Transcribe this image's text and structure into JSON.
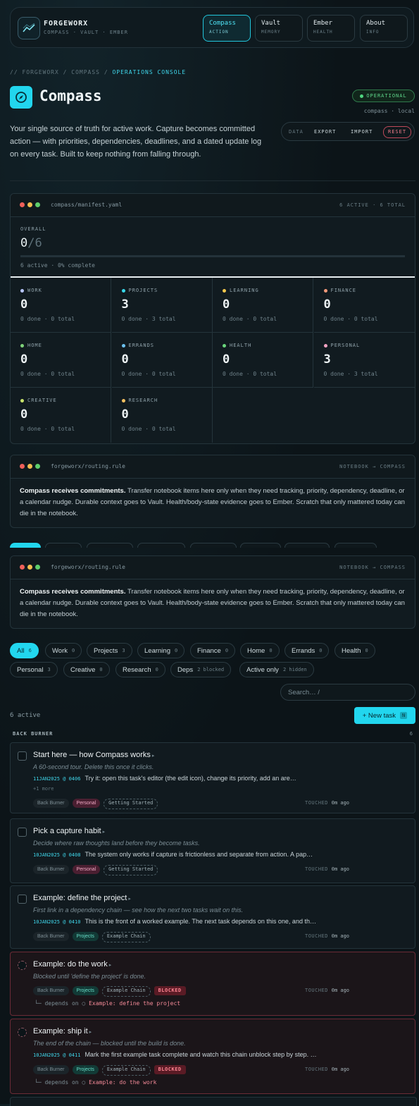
{
  "nav": {
    "brand": "FORGEWORX",
    "subtitle": "COMPASS · VAULT · EMBER",
    "tabs": [
      {
        "title": "Compass",
        "sub": "ACTION",
        "active": true
      },
      {
        "title": "Vault",
        "sub": "MEMORY",
        "active": false
      },
      {
        "title": "Ember",
        "sub": "HEALTH",
        "active": false
      },
      {
        "title": "About",
        "sub": "INFO",
        "active": false
      }
    ]
  },
  "breadcrumb": {
    "root": "// FORGEWORX",
    "sep": "/",
    "mid": "COMPASS",
    "current": "OPERATIONS CONSOLE"
  },
  "header": {
    "title": "Compass",
    "status": "OPERATIONAL",
    "host": "compass · local",
    "description": "Your single source of truth for active work. Capture becomes committed action — with priorities, dependencies, deadlines, and a dated update log on every task. Built to keep nothing from falling through."
  },
  "data_controls": {
    "label": "DATA",
    "export": "EXPORT",
    "import": "IMPORT",
    "reset": "RESET"
  },
  "manifest": {
    "file": "compass/manifest.yaml",
    "meta": "6 ACTIVE · 6 TOTAL",
    "overall_label": "OVERALL",
    "done": "0",
    "total": "/6",
    "progress": 0,
    "summary": "6 active · 0% complete",
    "categories": [
      {
        "name": "WORK",
        "value": "0",
        "sub": "0 done · 0 total",
        "color": "#b9c7ff"
      },
      {
        "name": "PROJECTS",
        "value": "3",
        "sub": "0 done · 3 total",
        "color": "#38d8ea"
      },
      {
        "name": "LEARNING",
        "value": "0",
        "sub": "0 done · 0 total",
        "color": "#f5c84c"
      },
      {
        "name": "FINANCE",
        "value": "0",
        "sub": "0 done · 0 total",
        "color": "#f59a7a"
      },
      {
        "name": "HOME",
        "value": "0",
        "sub": "0 done · 0 total",
        "color": "#7fd27a"
      },
      {
        "name": "ERRANDS",
        "value": "0",
        "sub": "0 done · 0 total",
        "color": "#6cc2f0"
      },
      {
        "name": "HEALTH",
        "value": "0",
        "sub": "0 done · 0 total",
        "color": "#6ad67c"
      },
      {
        "name": "PERSONAL",
        "value": "3",
        "sub": "0 done · 3 total",
        "color": "#f4a3c2"
      },
      {
        "name": "CREATIVE",
        "value": "0",
        "sub": "0 done · 0 total",
        "color": "#c9e46b"
      },
      {
        "name": "RESEARCH",
        "value": "0",
        "sub": "0 done · 0 total",
        "color": "#f5c060"
      }
    ]
  },
  "routing": {
    "file": "forgeworx/routing.rule",
    "meta": "NOTEBOOK → COMPASS",
    "lead": "Compass receives commitments.",
    "body": " Transfer notebook items here only when they need tracking, priority, dependency, deadline, or a calendar nudge. Durable context goes to Vault. Health/body-state evidence goes to Ember. Scratch that only mattered today can die in the notebook."
  },
  "filters": [
    {
      "label": "All",
      "count": "6",
      "active": true
    },
    {
      "label": "Work",
      "count": "0"
    },
    {
      "label": "Projects",
      "count": "3"
    },
    {
      "label": "Learning",
      "count": "0"
    },
    {
      "label": "Finance",
      "count": "0"
    },
    {
      "label": "Home",
      "count": "0"
    },
    {
      "label": "Errands",
      "count": "0"
    },
    {
      "label": "Health",
      "count": "0"
    },
    {
      "label": "Personal",
      "count": "3"
    },
    {
      "label": "Creative",
      "count": "0"
    },
    {
      "label": "Research",
      "count": "0"
    },
    {
      "label": "Deps",
      "count": "2 blocked"
    },
    {
      "label": "Active only",
      "count": "2 hidden"
    }
  ],
  "search": {
    "placeholder": "Search…  /"
  },
  "list": {
    "count": "6 active",
    "new_task": "+ New task",
    "new_task_key": "N",
    "section": "BACK BURNER",
    "section_count": "6",
    "touched_label": "TOUCHED",
    "depends_label": "└─ depends on  ○",
    "tasks": [
      {
        "title": "Start here — how Compass works",
        "subtitle": "A 60-second tour. Delete this once it clicks.",
        "ts": "11JAN2025 @ 0406",
        "log": "Try it: open this task's editor (the edit icon), change its priority, add an are…",
        "more": "+1 more",
        "bucket": "Back Burner",
        "cat": "Personal",
        "project": "Getting Started",
        "touched": "0m ago"
      },
      {
        "title": "Pick a capture habit",
        "subtitle": "Decide where raw thoughts land before they become tasks.",
        "ts": "10JAN2025 @ 0408",
        "log": "The system only works if capture is frictionless and separate from action. A pap…",
        "bucket": "Back Burner",
        "cat": "Personal",
        "project": "Getting Started",
        "touched": "0m ago"
      },
      {
        "title": "Example: define the project",
        "subtitle": "First link in a dependency chain — see how the next two tasks wait on this.",
        "ts": "10JAN2025 @ 0410",
        "log": "This is the front of a worked example. The next task depends on this one, and th…",
        "bucket": "Back Burner",
        "cat": "Projects",
        "project": "Example Chain",
        "touched": "0m ago"
      },
      {
        "title": "Example: do the work",
        "subtitle": "Blocked until 'define the project' is done.",
        "bucket": "Back Burner",
        "cat": "Projects",
        "project": "Example Chain",
        "blocked": "BLOCKED",
        "touched": "0m ago",
        "depends": "Example: define the project"
      },
      {
        "title": "Example: ship it",
        "subtitle": "The end of the chain — blocked until the build is done.",
        "ts": "10JAN2025 @ 0411",
        "log": "Mark the first example task complete and watch this chain unblock step by step. …",
        "bucket": "Back Burner",
        "cat": "Projects",
        "project": "Example Chain",
        "blocked": "BLOCKED",
        "touched": "0m ago",
        "depends": "Example: do the work"
      }
    ]
  }
}
